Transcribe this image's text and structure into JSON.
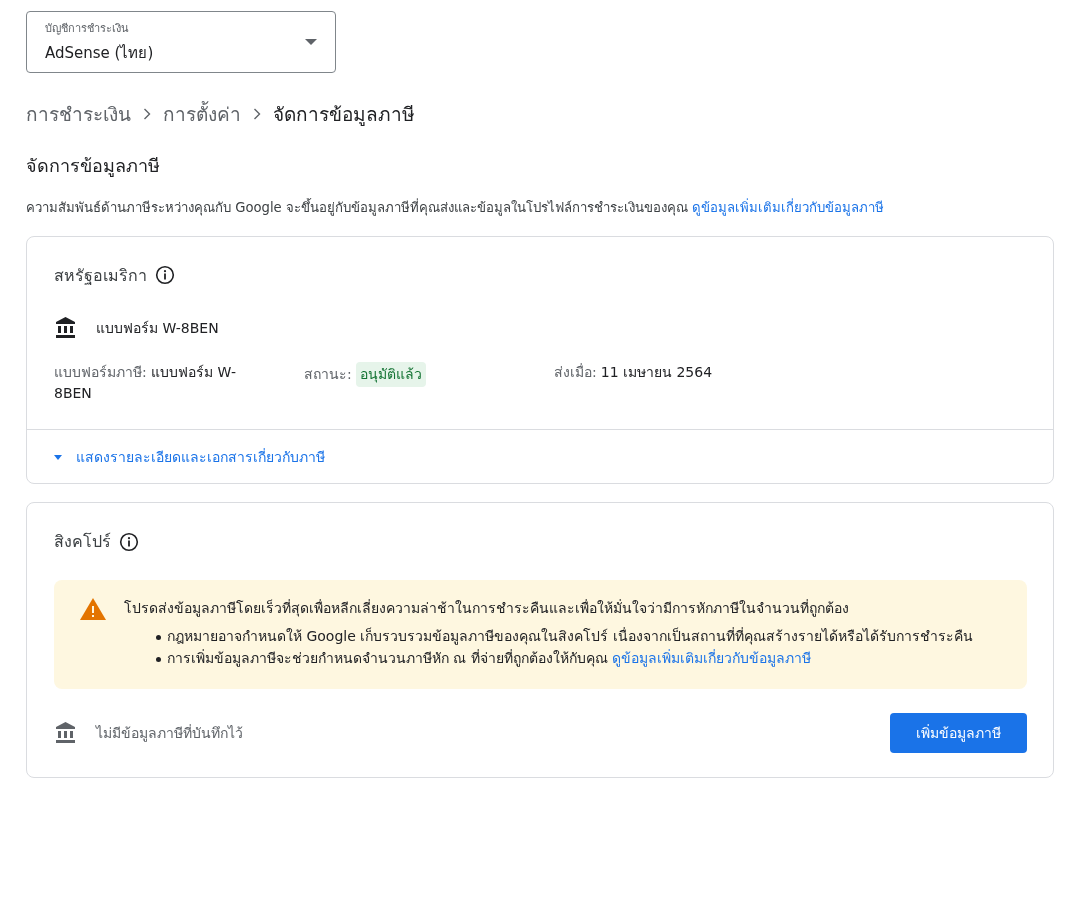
{
  "account_select": {
    "label": "บัญชีการชำระเงิน",
    "value": "AdSense (ไทย)"
  },
  "breadcrumb": [
    {
      "label": "การชำระเงิน",
      "selected": false
    },
    {
      "label": "การตั้งค่า",
      "selected": false
    },
    {
      "label": "จัดการข้อมูลภาษี",
      "selected": true
    }
  ],
  "title": "จัดการข้อมูลภาษี",
  "intro": {
    "text": "ความสัมพันธ์ด้านภาษีระหว่างคุณกับ Google จะขึ้นอยู่กับข้อมูลภาษีที่คุณส่งและข้อมูลในโปรไฟล์การชำระเงินของคุณ",
    "link": "ดูข้อมูลเพิ่มเติมเกี่ยวกับข้อมูลภาษี"
  },
  "us_card": {
    "title": "สหรัฐอเมริกา",
    "form_name": "แบบฟอร์ม W-8BEN",
    "form_type": {
      "label": "แบบฟอร์มภาษี:",
      "value": "แบบฟอร์ม W-8BEN"
    },
    "status": {
      "label": "สถานะ:",
      "value": "อนุมัติแล้ว"
    },
    "submitted": {
      "label": "ส่งเมื่อ:",
      "value": "11 เมษายน 2564"
    },
    "details_toggle": {
      "label": "แสดงรายละเอียดและเอกสารเกี่ยวกับภาษี",
      "expanded": false
    }
  },
  "sg_card": {
    "title": "สิงคโปร์",
    "warning": {
      "text": "โปรดส่งข้อมูลภาษีโดยเร็วที่สุดเพื่อหลีกเลี่ยงความล่าช้าในการชำระคืนและเพื่อให้มั่นใจว่ามีการหักภาษีในจำนวนที่ถูกต้อง",
      "bullets": [
        {
          "text": "กฎหมายอาจกำหนดให้ Google เก็บรวบรวมข้อมูลภาษีของคุณในสิงคโปร์ เนื่องจากเป็นสถานที่ที่คุณสร้างรายได้หรือได้รับการชำระคืน"
        },
        {
          "text": "การเพิ่มข้อมูลภาษีจะช่วยกำหนดจำนวนภาษีหัก ณ ที่จ่ายที่ถูกต้องให้กับคุณ",
          "link": "ดูข้อมูลเพิ่มเติมเกี่ยวกับข้อมูลภาษี"
        }
      ]
    },
    "empty_text": "ไม่มีข้อมูลภาษีที่บันทึกไว้",
    "button": "เพิ่มข้อมูลภาษี"
  }
}
